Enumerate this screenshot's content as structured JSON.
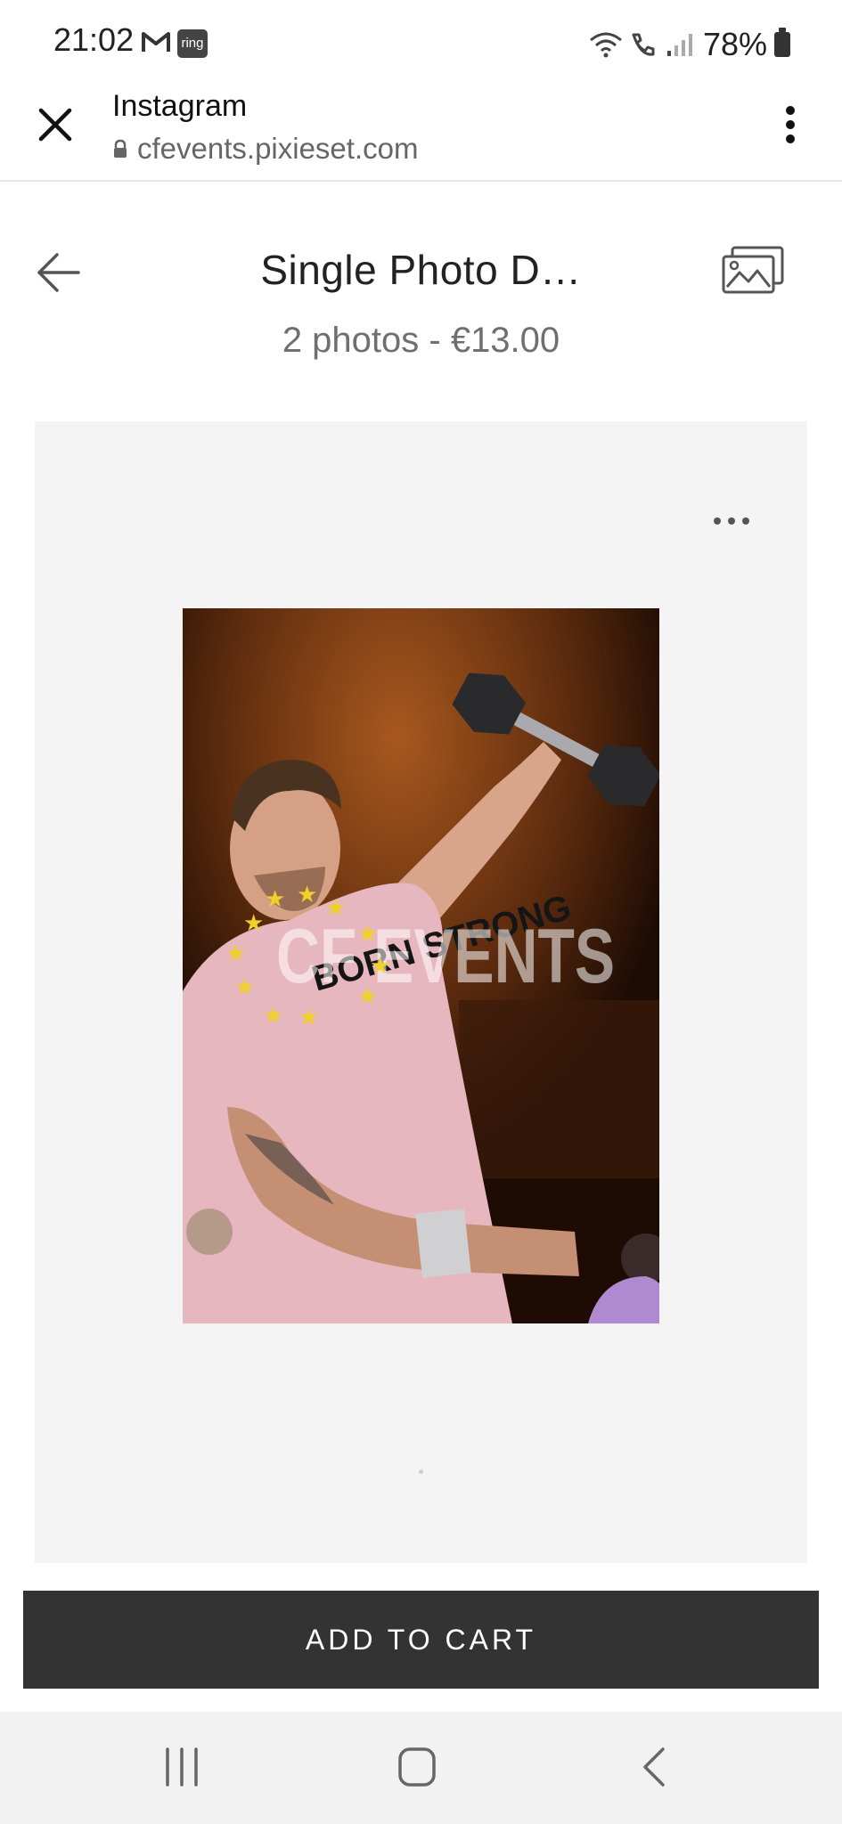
{
  "status_bar": {
    "time": "21:02",
    "ring_badge": "ring",
    "battery": "78%",
    "icons": [
      "gmail-icon",
      "ring-app-icon",
      "wifi-icon",
      "wifi-call-icon",
      "signal-icon",
      "battery-icon"
    ]
  },
  "browser": {
    "title": "Instagram",
    "url": "cfevents.pixieset.com",
    "icons": [
      "close-icon",
      "lock-icon",
      "more-vert-icon"
    ]
  },
  "header": {
    "title": "Single Photo D…",
    "subtitle": "2 photos - €13.00",
    "icons": [
      "arrow-left-icon",
      "gallery-icon"
    ]
  },
  "photo": {
    "watermark": "CF EVENTS",
    "shirt_text": "BORN STRONG",
    "icons": [
      "more-horizontal-icon"
    ]
  },
  "cart": {
    "button_label": "ADD TO CART"
  },
  "nav": {
    "icons": [
      "recents-icon",
      "home-icon",
      "back-icon"
    ]
  },
  "colors": {
    "button_bg": "#333333",
    "panel_bg": "#f4f4f5",
    "subtitle": "#6f6f6f"
  }
}
